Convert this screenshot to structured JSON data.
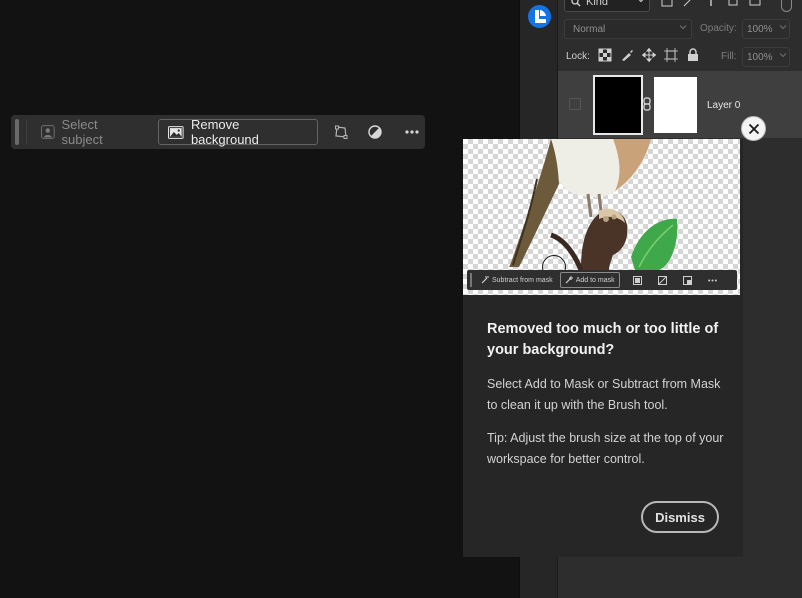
{
  "taskbar": {
    "select_subject_label": "Select subject",
    "remove_background_label": "Remove background",
    "icons": [
      "person-icon",
      "image-icon",
      "transform-icon",
      "contrast-icon",
      "more-icon"
    ]
  },
  "layers_panel": {
    "filter_kind_label": "Kind",
    "blend_mode": "Normal",
    "opacity_label": "Opacity:",
    "opacity_value": "100%",
    "lock_label": "Lock:",
    "fill_label": "Fill:",
    "fill_value": "100%",
    "layer_name": "Layer 0"
  },
  "coachmark": {
    "mini_toolbar": {
      "subtract_label": "Subtract from mask",
      "add_label": "Add to mask"
    },
    "title": "Removed too much or too little of your background?",
    "body": "Select Add to Mask or Subtract from Mask to clean it up with the Brush tool.",
    "tip": "Tip: Adjust the brush size at the top of your workspace for better control.",
    "dismiss_label": "Dismiss"
  },
  "colors": {
    "app_bg": "#121212",
    "panel_bg": "#2d2d2d",
    "accent_blue": "#1473e6",
    "popover_bg": "#262626"
  }
}
